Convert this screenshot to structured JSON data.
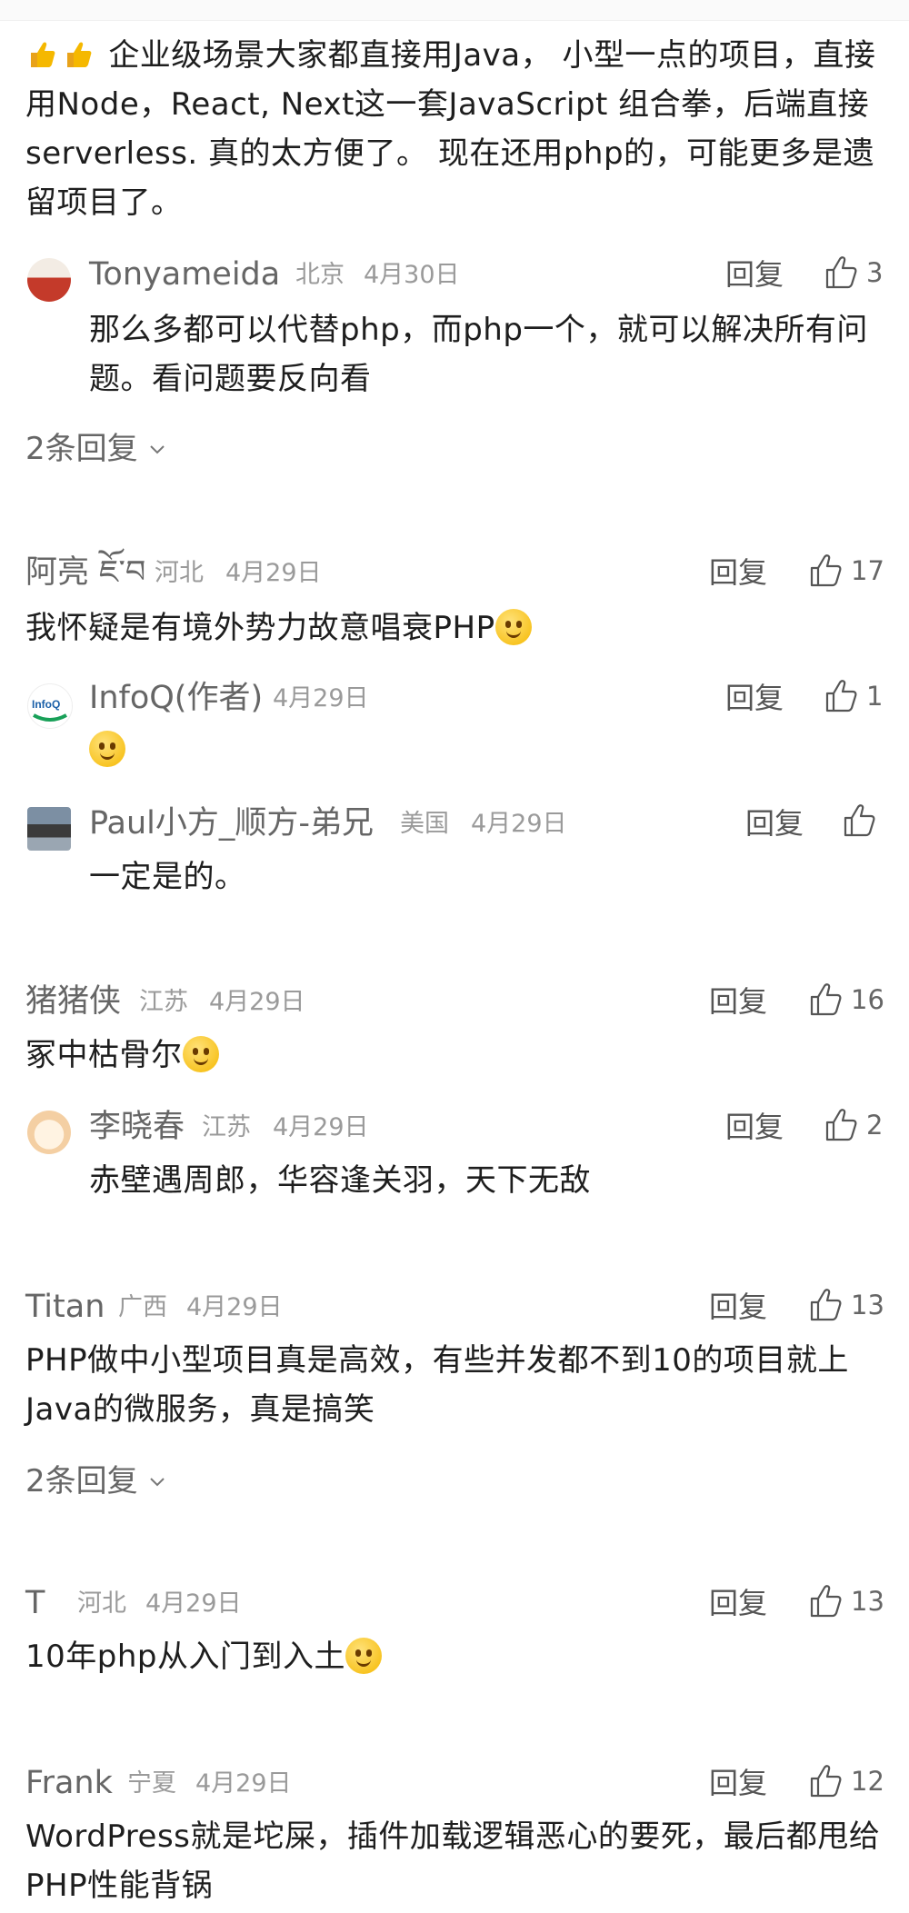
{
  "top_comment": {
    "text": "企业级场景大家都直接用Java， 小型一点的项目，直接用Node，React, Next这一套JavaScript 组合拳，后端直接serverless. 真的太方便了。 现在还用php的，可能更多是遗留项目了。",
    "replies": [
      {
        "user": "Tonyameida",
        "location": "北京",
        "date": "4月30日",
        "reply_label": "回复",
        "likes": "3",
        "text": "那么多都可以代替php，而php一个，就可以解决所有问题。看问题要反向看"
      }
    ],
    "more_replies": "2条回复"
  },
  "comments": [
    {
      "user": "阿亮 ཇོ་བ",
      "location": "河北",
      "date": "4月29日",
      "reply_label": "回复",
      "likes": "17",
      "text": "我怀疑是有境外势力故意唱衰PHP",
      "replies": [
        {
          "user": "InfoQ(作者)",
          "location": "",
          "date": "4月29日",
          "reply_label": "回复",
          "likes": "1",
          "text": ""
        },
        {
          "user": "Paul小方_顺方-弟兄",
          "location": "美国",
          "date": "4月29日",
          "reply_label": "回复",
          "likes": "",
          "text": "一定是的。"
        }
      ]
    },
    {
      "user": "猪猪侠",
      "location": "江苏",
      "date": "4月29日",
      "reply_label": "回复",
      "likes": "16",
      "text": "冢中枯骨尔",
      "replies": [
        {
          "user": "李晓春",
          "location": "江苏",
          "date": "4月29日",
          "reply_label": "回复",
          "likes": "2",
          "text": "赤壁遇周郎，华容逢关羽，天下无敌"
        }
      ]
    },
    {
      "user": "Titan",
      "location": "广西",
      "date": "4月29日",
      "reply_label": "回复",
      "likes": "13",
      "text": "PHP做中小型项目真是高效，有些并发都不到10的项目就上Java的微服务，真是搞笑",
      "more_replies": "2条回复"
    },
    {
      "user": "T",
      "location": "河北",
      "date": "4月29日",
      "reply_label": "回复",
      "likes": "13",
      "text": "10年php从入门到入土"
    },
    {
      "user": "Frank",
      "location": "宁夏",
      "date": "4月29日",
      "reply_label": "回复",
      "likes": "12",
      "text": "WordPress就是坨屎，插件加载逻辑恶心的要死，最后都甩给PHP性能背锅"
    }
  ],
  "colors": {
    "text": "#1e1e1e",
    "name": "#666666",
    "meta": "#9a9a9a",
    "background": "#ffffff"
  }
}
